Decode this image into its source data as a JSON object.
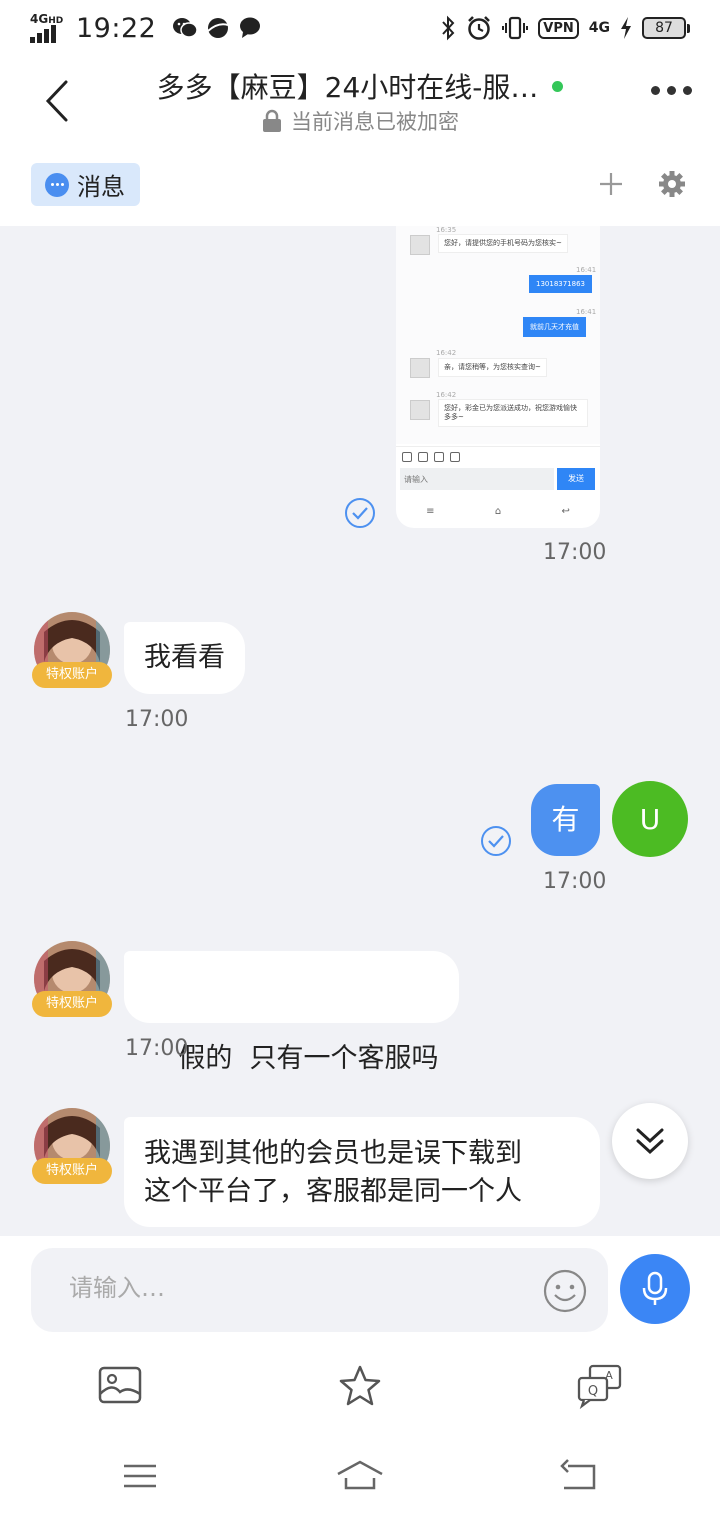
{
  "status_bar": {
    "network": "4G",
    "network_sup": "HD",
    "time": "19:22",
    "vpn": "VPN",
    "network2": "4G",
    "battery": "87"
  },
  "header": {
    "title": "多多【麻豆】24小时在线-服…",
    "encryption_notice": "当前消息已被加密",
    "online_color": "#34c759"
  },
  "tabs": {
    "messages_label": "消息"
  },
  "screenshot_card": {
    "t1": "16:35",
    "m1": "您好，请提供您的手机号码为您核实~",
    "t2": "16:41",
    "m2": "13018371863",
    "t3": "16:41",
    "m3": "就前几天才充值",
    "t4": "16:42",
    "m4": "亲，请您稍等，为您核实查询~",
    "t5": "16:42",
    "m5": "您好，彩金已为您派送成功，祝您游戏愉快多多~",
    "input_placeholder": "请输入",
    "send": "发送"
  },
  "messages": [
    {
      "time": "17:00"
    },
    {
      "text": "我看看",
      "badge": "特权账户",
      "time": "17:00"
    },
    {
      "text": "有",
      "avatar": "U",
      "time": "17:00"
    },
    {
      "text": "假的  只有一个客服吗",
      "badge": "特权账户",
      "time": "17:00"
    },
    {
      "line1": "我遇到其他的会员也是误下载到",
      "line2": "这个平台了，客服都是同一个人",
      "badge": "特权账户"
    }
  ],
  "input": {
    "placeholder": "请输入…"
  },
  "colors": {
    "accent": "#3b86f5",
    "outgoing_bubble": "#4d91f0",
    "user_avatar": "#4cbb23",
    "badge": "#f0b63d",
    "chat_bg": "#f1f2f6"
  }
}
